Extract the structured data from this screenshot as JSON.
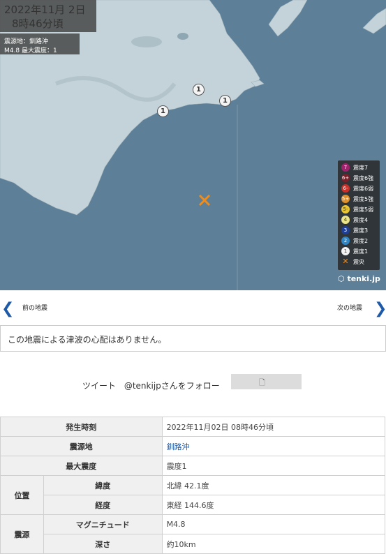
{
  "map": {
    "date_line": "2022年11月  2日",
    "time_line": "8時46分頃",
    "epicenter_line": "震源地：釧路沖",
    "magnitude_line": "M4.8    最大震度：1",
    "station_intensity": "1",
    "colors": {
      "water": "#5d7f98",
      "land": "#c4d3d9",
      "epicenter": "#f08c1a"
    },
    "legend": [
      {
        "symbol": "7",
        "label": "震度7",
        "color": "#a0226d"
      },
      {
        "symbol": "6+",
        "label": "震度6強",
        "color": "#7a1f2a"
      },
      {
        "symbol": "6-",
        "label": "震度6弱",
        "color": "#c8302a"
      },
      {
        "symbol": "5+",
        "label": "震度5強",
        "color": "#e09028"
      },
      {
        "symbol": "5-",
        "label": "震度5弱",
        "color": "#e9c533"
      },
      {
        "symbol": "4",
        "label": "震度4",
        "color": "#ece48a"
      },
      {
        "symbol": "3",
        "label": "震度3",
        "color": "#1f3f97"
      },
      {
        "symbol": "2",
        "label": "震度2",
        "color": "#2f86c6"
      },
      {
        "symbol": "1",
        "label": "震度1",
        "color": "#f4f4f4"
      },
      {
        "symbol": "✕",
        "label": "震央",
        "color": "#f08c1a"
      }
    ],
    "brand": "tenki.jp"
  },
  "nav": {
    "prev": "前の地震",
    "next": "次の地震"
  },
  "tsunami": "この地震による津波の心配はありません。",
  "social": {
    "tweet": "ツイート",
    "follow": "@tenkijpさんをフォロー"
  },
  "details": {
    "time_label": "発生時刻",
    "time_value": "2022年11月02日 08時46分頃",
    "epicenter_label": "震源地",
    "epicenter_value": "釧路沖",
    "max_label": "最大震度",
    "max_value": "震度1",
    "position_label": "位置",
    "lat_label": "緯度",
    "lat_value": "北緯 42.1度",
    "lon_label": "経度",
    "lon_value": "東経 144.6度",
    "source_label": "震源",
    "mag_label": "マグニチュード",
    "mag_value": "M4.8",
    "depth_label": "深さ",
    "depth_value": "約10km"
  }
}
